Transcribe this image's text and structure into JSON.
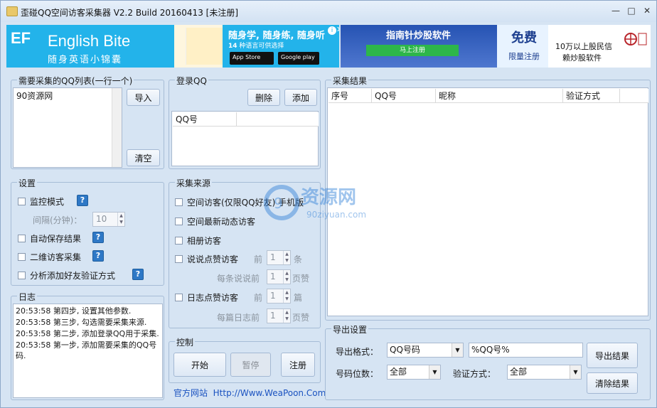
{
  "window": {
    "title": "歪碰QQ空间访客采集器 V2.2 Build 20160413 [未注册]",
    "min_glyph": "—",
    "max_glyph": "□",
    "close_glyph": "✕"
  },
  "ads": {
    "left": {
      "brand": "English Bite",
      "subtitle": "随身英语小锦囊",
      "slogan": "随身学, 随身练, 随身听",
      "slogan2_num": "14",
      "slogan2": "种语言可供选择",
      "app_store": "App Store",
      "google_play": "Google play",
      "logo": "EF"
    },
    "right": {
      "title": "指南针炒股软件",
      "register": "马上注册",
      "free": "免费",
      "free_sub": "限量注册",
      "line1": "10万以上股民信",
      "line2": "赖炒股软件"
    }
  },
  "qq_list": {
    "legend": "需要采集的QQ列表(一行一个)",
    "content": "90资源网",
    "import_btn": "导入",
    "clear_btn": "清空"
  },
  "login": {
    "legend": "登录QQ",
    "delete_btn": "删除",
    "add_btn": "添加",
    "col_qq": "QQ号"
  },
  "settings": {
    "legend": "设置",
    "monitor": "监控模式",
    "interval_label": "间隔(分钟)：",
    "interval_value": "10",
    "auto_save": "自动保存结果",
    "qrcode": "二维访客采集",
    "analyze": "分析添加好友验证方式",
    "help": "?"
  },
  "source": {
    "legend": "采集来源",
    "space_visitor": "空间访客(仅限QQ好友) 手机版",
    "recent_visitor": "空间最新动态访客",
    "album_visitor": "相册访客",
    "shuoshuo_like": "说说点赞访客",
    "front": "前",
    "shuoshuo_count": "1",
    "tiao": "条",
    "per_shuoshuo": "每条说说前",
    "per_shuoshuo_val": "1",
    "pages": "页赞",
    "blog_like": "日志点赞访客",
    "blog_count": "1",
    "pian": "篇",
    "per_blog": "每篇日志前",
    "per_blog_val": "1"
  },
  "log": {
    "legend": "日志",
    "lines": [
      "20:53:58   第四步, 设置其他参数.",
      "20:53:58   第三步, 勾选需要采集来源.",
      "20:53:58   第二步, 添加登录QQ用于采集.",
      "20:53:58   第一步, 添加需要采集的QQ号码."
    ]
  },
  "control": {
    "legend": "控制",
    "start": "开始",
    "pause": "暂停",
    "register": "注册",
    "site_label": "官方网站",
    "site_url": "Http://Www.WeaPoon.Com"
  },
  "results": {
    "legend": "采集结果",
    "columns": [
      "序号",
      "QQ号",
      "昵称",
      "验证方式"
    ]
  },
  "export": {
    "legend": "导出设置",
    "format_label": "导出格式：",
    "format_value": "QQ号码",
    "format_template": "%QQ号%",
    "digits_label": "号码位数：",
    "digits_value": "全部",
    "verify_label": "验证方式：",
    "verify_value": "全部",
    "export_btn": "导出结果",
    "clear_btn": "清除结果"
  },
  "watermark": {
    "text": "资源网",
    "url": "90ziyuan.com"
  }
}
